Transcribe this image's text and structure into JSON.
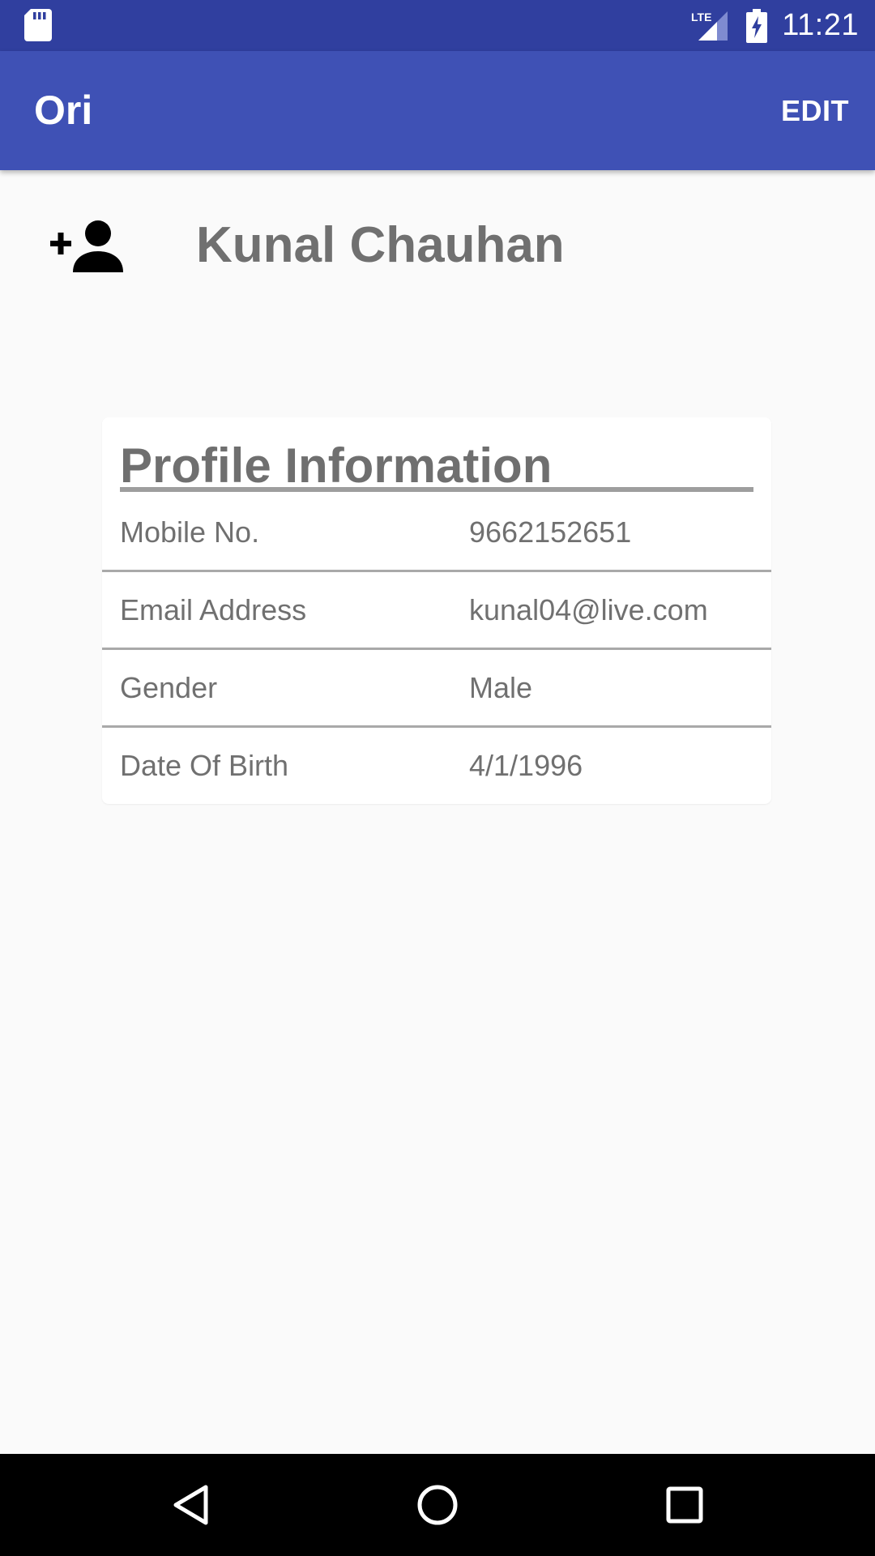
{
  "status_bar": {
    "time": "11:21",
    "network_label": "LTE",
    "icons": [
      "sd-card-icon",
      "signal-icon",
      "battery-charging-icon"
    ]
  },
  "app_bar": {
    "title": "Ori",
    "edit_label": "EDIT"
  },
  "profile": {
    "icon": "add-person-icon",
    "name": "Kunal Chauhan"
  },
  "profile_info": {
    "title": "Profile Information",
    "rows": [
      {
        "label": "Mobile No.",
        "value": "9662152651"
      },
      {
        "label": "Email Address",
        "value": "kunal04@live.com"
      },
      {
        "label": "Gender",
        "value": "Male"
      },
      {
        "label": "Date Of Birth",
        "value": "4/1/1996"
      }
    ]
  },
  "nav_bar": {
    "icons": [
      "back-icon",
      "home-icon",
      "recents-icon"
    ]
  },
  "colors": {
    "status_bar": "#303f9f",
    "app_bar": "#3f51b5",
    "text_gray": "#707070"
  }
}
